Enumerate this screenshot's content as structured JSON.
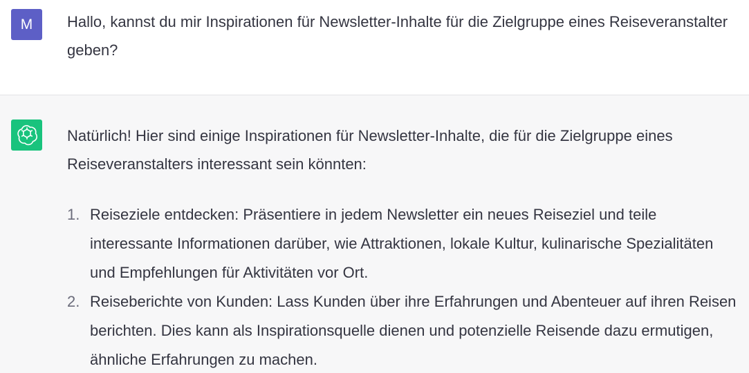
{
  "user": {
    "avatar_letter": "M",
    "message": "Hallo, kannst du mir Inspirationen für Newsletter-Inhalte für die Zielgruppe eines Reiseveranstalter geben?"
  },
  "assistant": {
    "intro": "Natürlich! Hier sind einige Inspirationen für Newsletter-Inhalte, die für die Zielgruppe eines Reiseveranstalters interessant sein könnten:",
    "items": [
      {
        "number": "1.",
        "text": "Reiseziele entdecken: Präsentiere in jedem Newsletter ein neues Reiseziel und teile interessante Informationen darüber, wie Attraktionen, lokale Kultur, kulinarische Spezialitäten und Empfehlungen für Aktivitäten vor Ort."
      },
      {
        "number": "2.",
        "text": "Reiseberichte von Kunden: Lass Kunden über ihre Erfahrungen und Abenteuer auf ihren Reisen berichten. Dies kann als Inspirationsquelle dienen und potenzielle Reisende dazu ermutigen, ähnliche Erfahrungen zu machen."
      }
    ]
  },
  "colors": {
    "user_avatar_bg": "#5d5fc6",
    "assistant_avatar_bg": "#19c37d",
    "assistant_bg": "#f7f7f8",
    "text": "#343541"
  },
  "icons": {
    "assistant_avatar": "openai-logo-icon"
  }
}
